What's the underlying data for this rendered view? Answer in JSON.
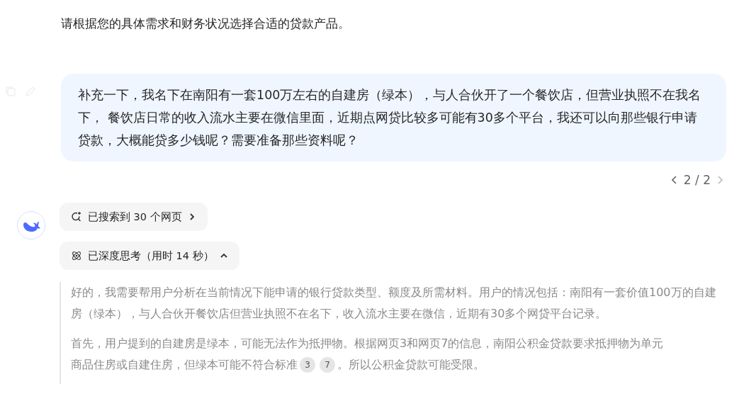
{
  "previous_answer": {
    "closing_text": "请根据您的具体需求和财务状况选择合适的贷款产品。"
  },
  "user_message": {
    "text": "补充一下，我名下在南阳有一套100万左右的自建房（绿本），与人合伙开了一个餐饮店，但营业执照不在我名下， 餐饮店日常的收入流水主要在微信里面，近期点网贷比较多可能有30多个平台，我还可以向那些银行申请贷款，大概能贷多少钱呢？需要准备那些资料呢？",
    "pager": "2 / 2"
  },
  "assistant": {
    "search_chip": {
      "label": "已搜索到 30 个网页"
    },
    "thinking_chip": {
      "label": "已深度思考（用时 14 秒）",
      "expanded": true
    },
    "thinking": [
      {
        "lines": [
          [
            {
              "kind": "text",
              "text": "好的，我需要帮用户分析在当前情况下能申请的银行贷款类型、额度及所需材料。用户的情况包括：南阳有一套价值100万的自建房（绿本），与人合伙开餐饮店但营业执照不在名下，收入流水主要在微信，近期有30多个网贷平台记录。"
            }
          ]
        ]
      },
      {
        "lines": [
          [
            {
              "kind": "text",
              "text": "首先，用户提到的自建房是绿本，可能无法作为抵押物。根据网页3和网页7的信息，南阳公积金贷款要求抵押物为单元"
            }
          ],
          [
            {
              "kind": "text",
              "text": "商品住房或自建住房，但绿本可能不符合标准"
            },
            {
              "kind": "cite",
              "text": "3"
            },
            {
              "kind": "cite",
              "text": "7"
            },
            {
              "kind": "text",
              "text": "。所以公积金贷款可能受限。"
            }
          ]
        ]
      }
    ]
  }
}
